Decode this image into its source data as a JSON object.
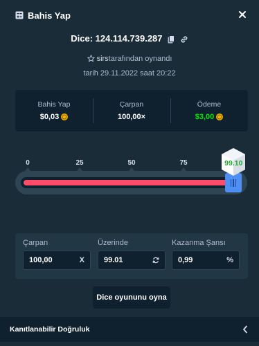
{
  "header": {
    "title": "Bahis Yap",
    "icon": "receipt-icon"
  },
  "dice": {
    "id_text": "Dice: 124.114.739.287"
  },
  "played_by": {
    "user": "sirs",
    "suffix": "tarafından oynandı"
  },
  "date": {
    "text": "tarih 29.11.2022 saat 20:22"
  },
  "stats": [
    {
      "label": "Bahis Yap",
      "value": "$0,03",
      "coin": true,
      "color": "#ffffff"
    },
    {
      "label": "Çarpan",
      "value": "100,00×",
      "coin": false,
      "color": "#ffffff"
    },
    {
      "label": "Ödeme",
      "value": "$3,00",
      "coin": true,
      "color": "#00e701"
    }
  ],
  "slider": {
    "ticks": [
      "0",
      "25",
      "50",
      "75",
      "100"
    ],
    "target": 99.01,
    "result": "99.10",
    "fill_color": "#ff4c6a"
  },
  "fields": {
    "multiplier": {
      "label": "Çarpan",
      "value": "100,00",
      "suffix": "X"
    },
    "roll_over": {
      "label": "Üzerinde",
      "value": "99.01"
    },
    "win_chance": {
      "label": "Kazanma Şansı",
      "value": "0,99",
      "suffix": "%"
    }
  },
  "play_button": {
    "label": "Dice oyununu oyna"
  },
  "footer": {
    "label": "Kanıtlanabilir Doğruluk"
  }
}
